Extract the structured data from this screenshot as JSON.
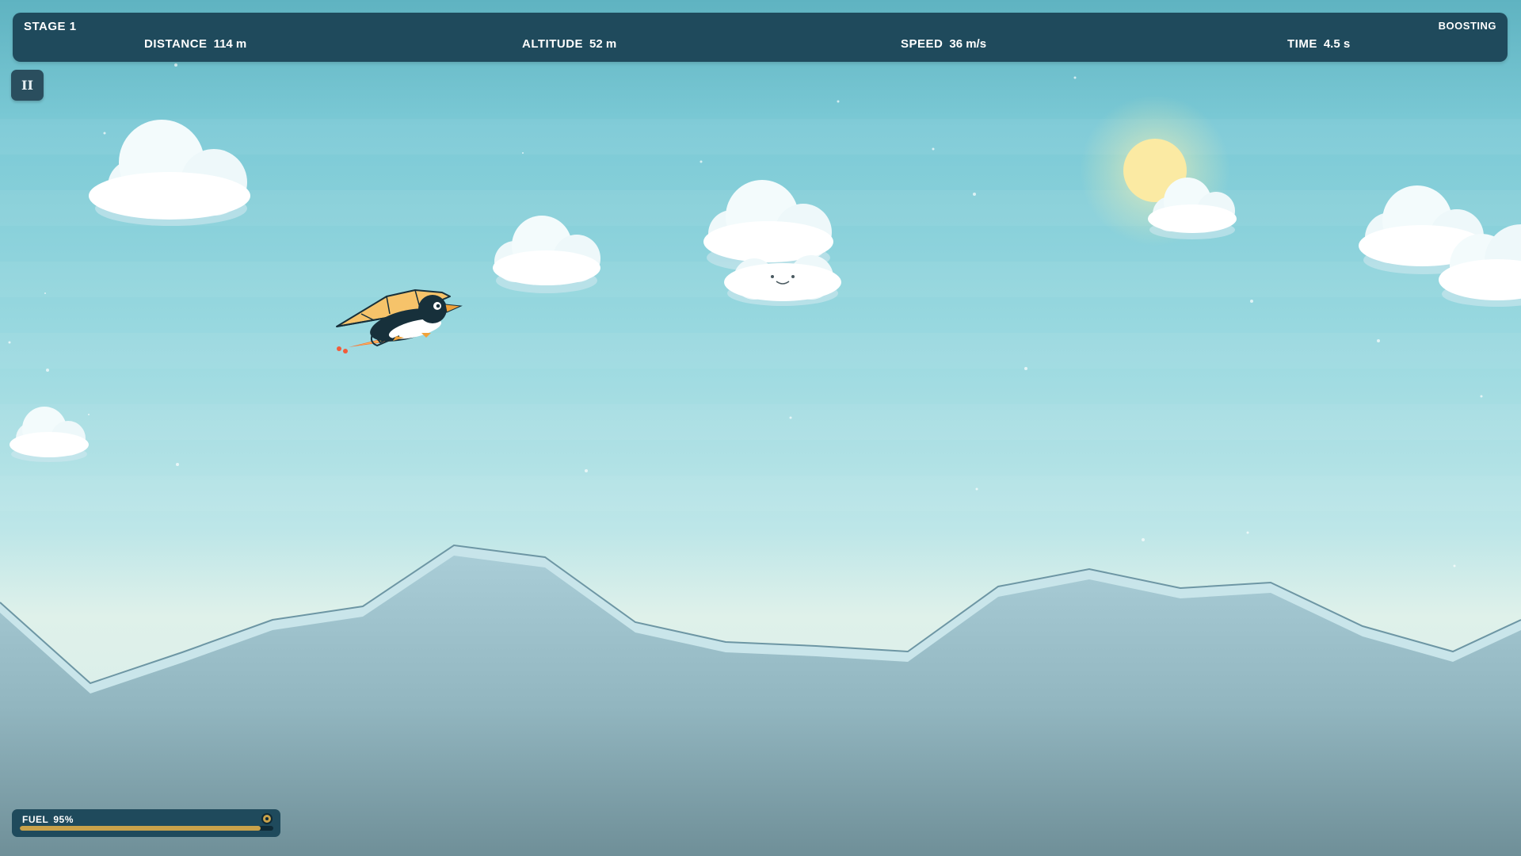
{
  "hud": {
    "stage": "STAGE 1",
    "status": "BOOSTING",
    "stats": [
      {
        "label": "DISTANCE",
        "value": "114 m"
      },
      {
        "label": "ALTITUDE",
        "value": "52 m"
      },
      {
        "label": "SPEED",
        "value": "36 m/s"
      },
      {
        "label": "TIME",
        "value": "4.5 s"
      }
    ]
  },
  "pause": {
    "label": "II"
  },
  "fuel": {
    "label": "FUEL",
    "value": "95%",
    "level": 0.95
  },
  "colors": {
    "hud_bg": "#1f4a5c",
    "fuel_fill": "#c9a24a",
    "glider_wing": "#f6c36a",
    "beak": "#f0a23a",
    "sun": "#fbeaa3"
  },
  "icons": {
    "pause": "pause-icon",
    "fuel": "fuel-gauge-icon",
    "player": "penguin-hang-glider",
    "sun": "sun"
  }
}
